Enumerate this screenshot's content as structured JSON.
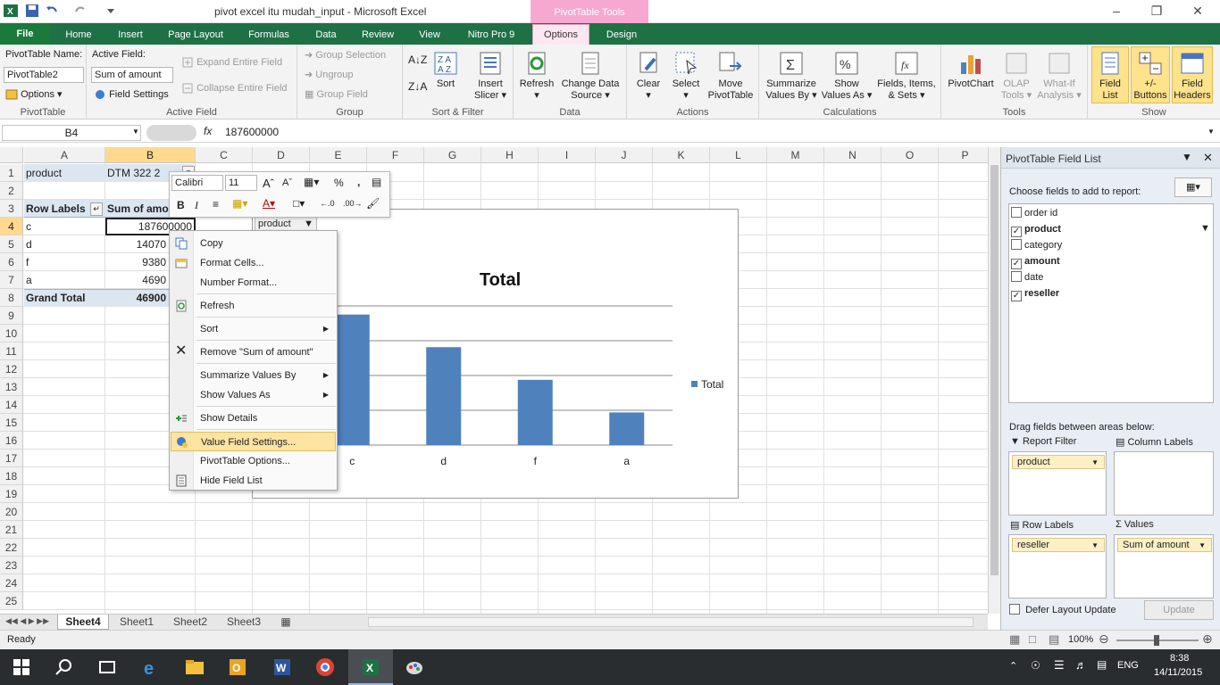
{
  "titlebar": {
    "title": "pivot excel itu mudah_input - Microsoft Excel",
    "context_tab_group": "PivotTable Tools"
  },
  "tabs": [
    "File",
    "Home",
    "Insert",
    "Page Layout",
    "Formulas",
    "Data",
    "Review",
    "View",
    "Nitro Pro 9",
    "Options",
    "Design"
  ],
  "ribbon": {
    "pivottable": {
      "name_label": "PivotTable Name:",
      "name_value": "PivotTable2",
      "options": "Options",
      "group": "PivotTable"
    },
    "active_field": {
      "label": "Active Field:",
      "value": "Sum of amount",
      "field_settings": "Field Settings",
      "expand": "Expand Entire Field",
      "collapse": "Collapse Entire Field",
      "group": "Active Field"
    },
    "group_grp": {
      "group_selection": "Group Selection",
      "ungroup": "Ungroup",
      "group_field": "Group Field",
      "group": "Group"
    },
    "sort": {
      "sort": "Sort",
      "group": "Sort & Filter",
      "insert_slicer_1": "Insert",
      "insert_slicer_2": "Slicer"
    },
    "data": {
      "refresh": "Refresh",
      "change_1": "Change Data",
      "change_2": "Source",
      "group": "Data"
    },
    "actions": {
      "clear": "Clear",
      "select": "Select",
      "move_1": "Move",
      "move_2": "PivotTable",
      "group": "Actions"
    },
    "calc": {
      "summ_1": "Summarize",
      "summ_2": "Values By",
      "show_1": "Show",
      "show_2": "Values As",
      "fields_1": "Fields, Items,",
      "fields_2": "& Sets",
      "group": "Calculations"
    },
    "tools": {
      "pivotchart": "PivotChart",
      "olap_1": "OLAP",
      "olap_2": "Tools",
      "whatif_1": "What-If",
      "whatif_2": "Analysis",
      "group": "Tools"
    },
    "show": {
      "fieldlist_1": "Field",
      "fieldlist_2": "List",
      "buttons_1": "+/-",
      "buttons_2": "Buttons",
      "headers_1": "Field",
      "headers_2": "Headers",
      "group": "Show"
    }
  },
  "formula_bar": {
    "name_box": "B4",
    "fx": "fx",
    "value": "187600000"
  },
  "columns": [
    "A",
    "B",
    "C",
    "D",
    "E",
    "F",
    "G",
    "H",
    "I",
    "J",
    "K",
    "L",
    "M",
    "N",
    "O",
    "P"
  ],
  "rows": [
    "1",
    "2",
    "3",
    "4",
    "5",
    "6",
    "7",
    "8",
    "9",
    "10",
    "11",
    "12",
    "13",
    "14",
    "15",
    "16",
    "17",
    "18",
    "19",
    "20",
    "21",
    "22",
    "23",
    "24",
    "25"
  ],
  "cells": {
    "a1": "product",
    "b1": "DTM 322 2",
    "a3": "Row Labels",
    "b3": "Sum of amo",
    "a4": "c",
    "b4": "187600000",
    "a5": "d",
    "b5": "14070",
    "a6": "f",
    "b6": "9380",
    "a7": "a",
    "b7": "4690",
    "a8": "Grand Total",
    "b8": "46900"
  },
  "minibar": {
    "font": "Calibri",
    "size": "11",
    "bold": "B",
    "italic": "I",
    "percent": "%",
    "comma": ","
  },
  "context_menu": {
    "copy": "Copy",
    "format_cells": "Format Cells...",
    "number_format": "Number Format...",
    "refresh": "Refresh",
    "sort": "Sort",
    "remove": "Remove \"Sum of amount\"",
    "summarize": "Summarize Values By",
    "show_values": "Show Values As",
    "show_details": "Show Details",
    "value_field_settings": "Value Field Settings...",
    "pivot_options": "PivotTable Options...",
    "hide_field_list": "Hide Field List"
  },
  "chart": {
    "filter_button": "product",
    "legend": "Total"
  },
  "chart_data": {
    "type": "bar",
    "title": "Total",
    "categories": [
      "c",
      "d",
      "f",
      "a"
    ],
    "series": [
      {
        "name": "Total",
        "values": [
          187600000,
          140700000,
          93800000,
          46900000
        ]
      }
    ],
    "ylim": [
      0,
      200000000
    ],
    "grid": true,
    "legend_position": "right",
    "bar_color": "#4f81bd"
  },
  "field_list": {
    "title": "PivotTable Field List",
    "choose": "Choose fields to add to report:",
    "fields": [
      {
        "name": "order id",
        "checked": false
      },
      {
        "name": "product",
        "checked": true
      },
      {
        "name": "category",
        "checked": false
      },
      {
        "name": "amount",
        "checked": true
      },
      {
        "name": "date",
        "checked": false
      },
      {
        "name": "reseller",
        "checked": true
      }
    ],
    "drag": "Drag fields between areas below:",
    "report_filter": "Report Filter",
    "column_labels": "Column Labels",
    "row_labels": "Row Labels",
    "values": "Values",
    "filter_chip": "product",
    "row_chip": "reseller",
    "values_chip": "Sum of amount",
    "defer": "Defer Layout Update",
    "update": "Update"
  },
  "sheets": [
    "Sheet4",
    "Sheet1",
    "Sheet2",
    "Sheet3"
  ],
  "status": {
    "ready": "Ready",
    "zoom": "100%"
  },
  "taskbar": {
    "lang": "ENG",
    "time": "8:38",
    "date": "14/11/2015"
  }
}
